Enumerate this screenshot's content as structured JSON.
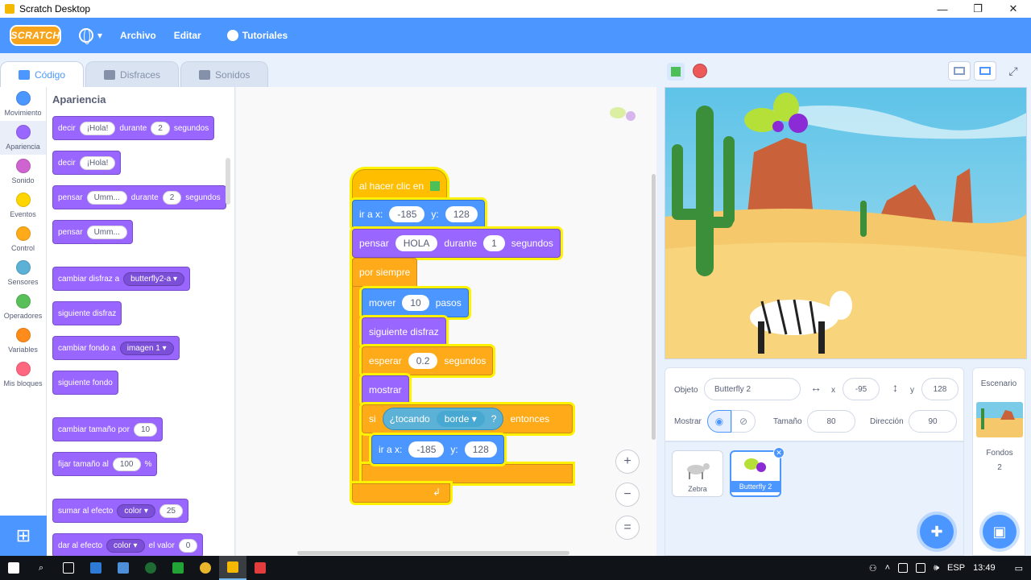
{
  "window": {
    "title": "Scratch Desktop",
    "minimize": "—",
    "maximize": "❐",
    "close": "✕"
  },
  "menubar": {
    "logo": "SCRATCH",
    "file": "Archivo",
    "edit": "Editar",
    "tutorials": "Tutoriales"
  },
  "tabs": [
    {
      "label": "Código",
      "active": true
    },
    {
      "label": "Disfraces",
      "active": false
    },
    {
      "label": "Sonidos",
      "active": false
    }
  ],
  "categories": [
    {
      "label": "Movimiento",
      "color": "#4c97ff"
    },
    {
      "label": "Apariencia",
      "color": "#9966ff",
      "selected": true
    },
    {
      "label": "Sonido",
      "color": "#cf63cf"
    },
    {
      "label": "Eventos",
      "color": "#ffd500"
    },
    {
      "label": "Control",
      "color": "#ffab19"
    },
    {
      "label": "Sensores",
      "color": "#5cb1d6"
    },
    {
      "label": "Operadores",
      "color": "#59c059"
    },
    {
      "label": "Variables",
      "color": "#ff8c1a"
    },
    {
      "label": "Mis bloques",
      "color": "#ff6680"
    }
  ],
  "palette": {
    "title": "Apariencia",
    "say_for": {
      "a": "decir",
      "msg": "¡Hola!",
      "b": "durante",
      "secs": "2",
      "c": "segundos"
    },
    "say": {
      "a": "decir",
      "msg": "¡Hola!"
    },
    "think_for": {
      "a": "pensar",
      "msg": "Umm...",
      "b": "durante",
      "secs": "2",
      "c": "segundos"
    },
    "think": {
      "a": "pensar",
      "msg": "Umm..."
    },
    "switch_costume": {
      "a": "cambiar disfraz a",
      "costume": "butterfly2-a"
    },
    "next_costume": "siguiente disfraz",
    "switch_backdrop": {
      "a": "cambiar fondo a",
      "backdrop": "imagen 1"
    },
    "next_backdrop": "siguiente fondo",
    "change_size": {
      "a": "cambiar tamaño por",
      "val": "10"
    },
    "set_size": {
      "a": "fijar tamaño al",
      "val": "100",
      "b": "%"
    },
    "change_effect": {
      "a": "sumar al efecto",
      "effect": "color",
      "val": "25"
    },
    "set_effect": {
      "a": "dar al efecto",
      "effect": "color",
      "b": "el valor",
      "val": "0"
    }
  },
  "script": {
    "hat": "al hacer clic en",
    "goto1": {
      "a": "ir a x:",
      "x": "-185",
      "b": "y:",
      "y": "128"
    },
    "think_for": {
      "a": "pensar",
      "msg": "HOLA",
      "b": "durante",
      "secs": "1",
      "c": "segundos"
    },
    "forever": "por siempre",
    "move": {
      "a": "mover",
      "steps": "10",
      "b": "pasos"
    },
    "next_costume": "siguiente disfraz",
    "wait": {
      "a": "esperar",
      "secs": "0.2",
      "b": "segundos"
    },
    "show": "mostrar",
    "if": {
      "a": "si",
      "b": "entonces"
    },
    "touching": {
      "a": "¿tocando",
      "what": "borde",
      "b": "?"
    },
    "goto2": {
      "a": "ir a x:",
      "x": "-185",
      "b": "y:",
      "y": "128"
    }
  },
  "zoom": {
    "in": "+",
    "out": "−",
    "reset": "="
  },
  "sprite_info": {
    "sprite_label": "Objeto",
    "sprite_name": "Butterfly 2",
    "x_label": "x",
    "x": "-95",
    "y_label": "y",
    "y": "128",
    "show_label": "Mostrar",
    "size_label": "Tamaño",
    "size": "80",
    "direction_label": "Dirección",
    "direction": "90"
  },
  "sprites": [
    {
      "name": "Zebra",
      "selected": false
    },
    {
      "name": "Butterfly 2",
      "selected": true
    }
  ],
  "backdrop": {
    "title": "Escenario",
    "count_label": "Fondos",
    "count": "2"
  },
  "taskbar": {
    "lang": "ESP",
    "time": "13:49"
  }
}
